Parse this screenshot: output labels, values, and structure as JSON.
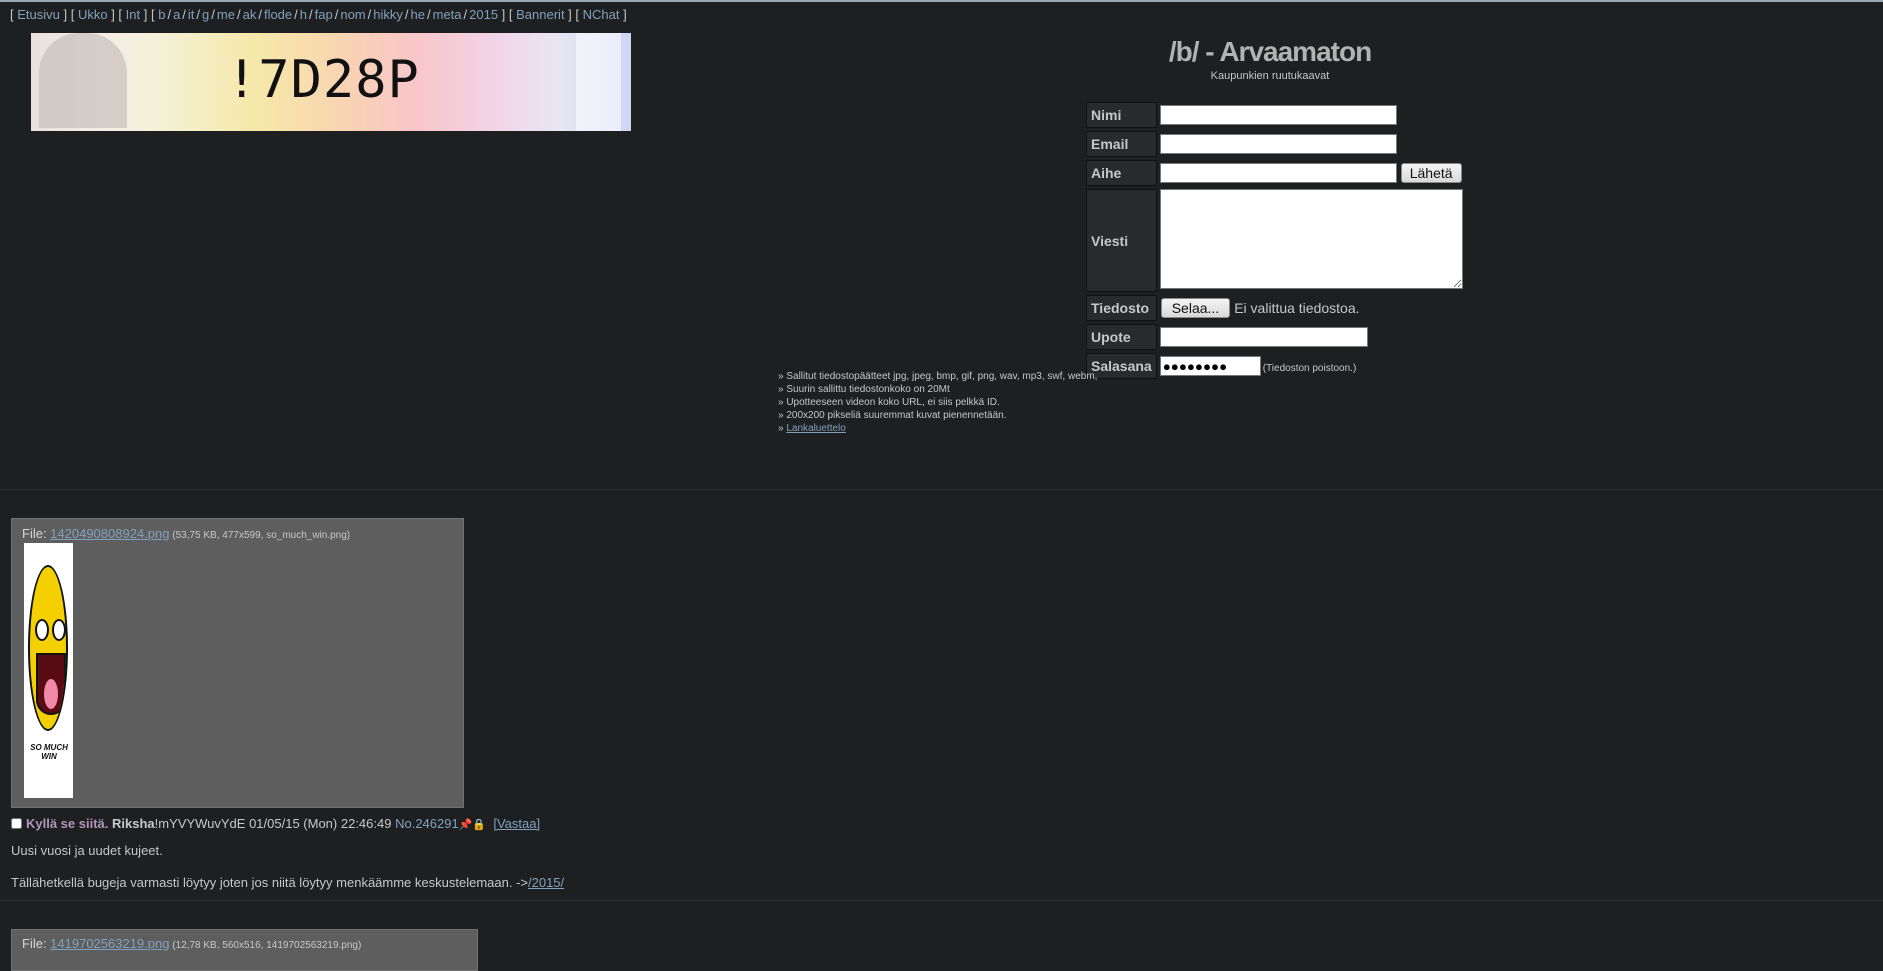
{
  "topnav": {
    "groups": [
      [
        "Etusivu"
      ],
      [
        "Ukko"
      ],
      [
        "Int"
      ],
      [
        "b",
        "a",
        "it",
        "g",
        "me",
        "ak",
        "flode",
        "h",
        "fap",
        "nom",
        "hikky",
        "he",
        "meta",
        "2015"
      ],
      [
        "Bannerit"
      ],
      [
        "NChat"
      ]
    ]
  },
  "banner": {
    "captcha_text": "!7D28P"
  },
  "board": {
    "title": "/b/ - Arvaamaton",
    "subtitle": "Kaupunkien ruutukaavat"
  },
  "form": {
    "name_label": "Nimi",
    "email_label": "Email",
    "subject_label": "Aihe",
    "submit_label": "Lähetä",
    "message_label": "Viesti",
    "file_label": "Tiedosto",
    "browse_label": "Selaa...",
    "no_file_text": "Ei valittua tiedostoa.",
    "embed_label": "Upote",
    "password_label": "Salasana",
    "password_value": "●●●●●●●●",
    "password_note": "(Tiedoston poistoon.)"
  },
  "rules": [
    "» Sallitut tiedostopäätteet jpg, jpeg, bmp, gif, png, wav, mp3, swf, webm,",
    "» Suurin sallittu tiedostonkoko on 20Mt",
    "» Upotteeseen videon koko URL, ei siis pelkkä ID.",
    "» 200x200 pikseliä suuremmat kuvat pienennetään."
  ],
  "rules_link_prefix": "» ",
  "rules_link": "Lankaluettelo",
  "post1": {
    "file_prefix": "File: ",
    "file_link": "1420490808924.png",
    "file_meta": " (53,75 KB, 477x599, so_much_win.png)",
    "thumb_caption": "SO MUCH WIN",
    "subject": "Kyllä se siitä.",
    "name": "Riksha",
    "trip": "!mYVYWuvYdE",
    "datetime": "01/05/15 (Mon) 22:46:49",
    "post_no": "No.246291",
    "icons": "📌🔒",
    "reply_label": "[Vastaa]",
    "message_line1": "Uusi vuosi ja uudet kujeet.",
    "message_line2": "Tällähetkellä bugeja varmasti löytyy joten jos niitä löytyy menkäämme keskustelemaan. ->",
    "message_link": "/2015/"
  },
  "post2": {
    "file_prefix": "File: ",
    "file_link": "1419702563219.png",
    "file_meta": " (12,78 KB, 560x516, 1419702563219.png)"
  }
}
